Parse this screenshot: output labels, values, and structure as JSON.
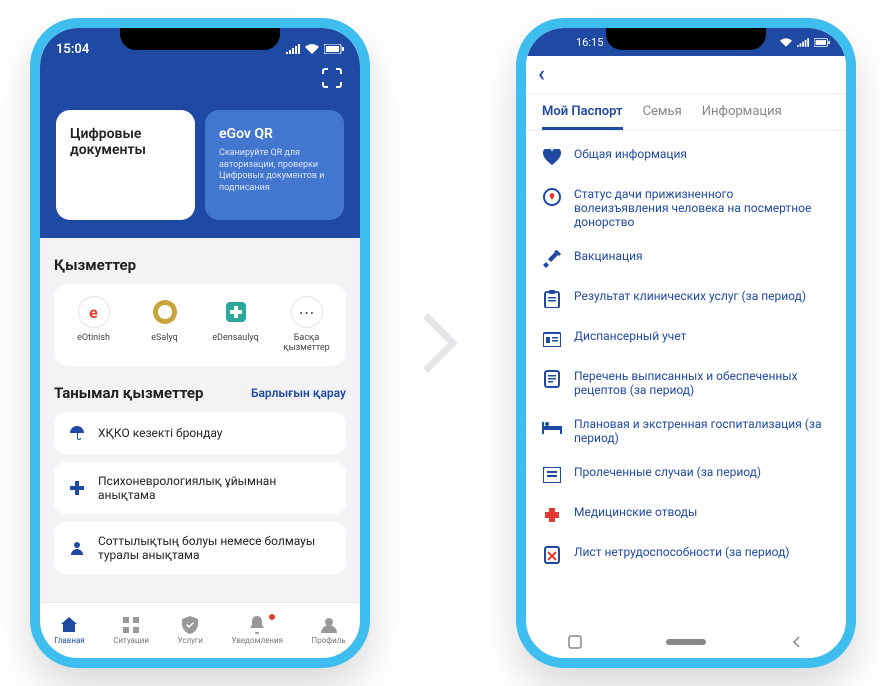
{
  "phone1": {
    "status": {
      "time": "15:04"
    },
    "top_cards": [
      {
        "title": "Цифровые документы",
        "desc": ""
      },
      {
        "title": "eGov QR",
        "desc": "Сканируйте QR для авторизации, проверки Цифровых документов и подписания"
      }
    ],
    "services_title": "Қызметтер",
    "services": [
      {
        "label": "eOtinish"
      },
      {
        "label": "eSalyq"
      },
      {
        "label": "eDensaulyq"
      },
      {
        "label": "Басқа қызметтер"
      }
    ],
    "popular_title": "Танымал қызметтер",
    "view_all": "Барлығын қарау",
    "popular": [
      {
        "label": "ХҚКО кезекті брондау"
      },
      {
        "label": "Психоневрологиялық ұйымнан анықтама"
      },
      {
        "label": "Соттылықтың болуы немесе болмауы туралы анықтама"
      }
    ],
    "nav": [
      {
        "label": "Главная"
      },
      {
        "label": "Ситуации"
      },
      {
        "label": "Услуги"
      },
      {
        "label": "Уведомления"
      },
      {
        "label": "Профиль"
      }
    ]
  },
  "phone2": {
    "status": {
      "time": "16:15"
    },
    "tabs": [
      {
        "label": "Мой Паспорт",
        "active": true
      },
      {
        "label": "Семья",
        "active": false
      },
      {
        "label": "Информация",
        "active": false
      }
    ],
    "items": [
      {
        "label": "Общая информация"
      },
      {
        "label": "Статус дачи прижизненного волеизъявления человека на посмертное донорство"
      },
      {
        "label": "Вакцинация"
      },
      {
        "label": "Результат клинических услуг (за период)"
      },
      {
        "label": "Диспансерный учет"
      },
      {
        "label": "Перечень выписанных и обеспеченных рецептов (за период)"
      },
      {
        "label": "Плановая и экстренная госпитализация (за период)"
      },
      {
        "label": "Пролеченные случаи (за период)"
      },
      {
        "label": "Медицинские отводы"
      },
      {
        "label": "Лист нетрудоспособности (за период)"
      }
    ]
  }
}
